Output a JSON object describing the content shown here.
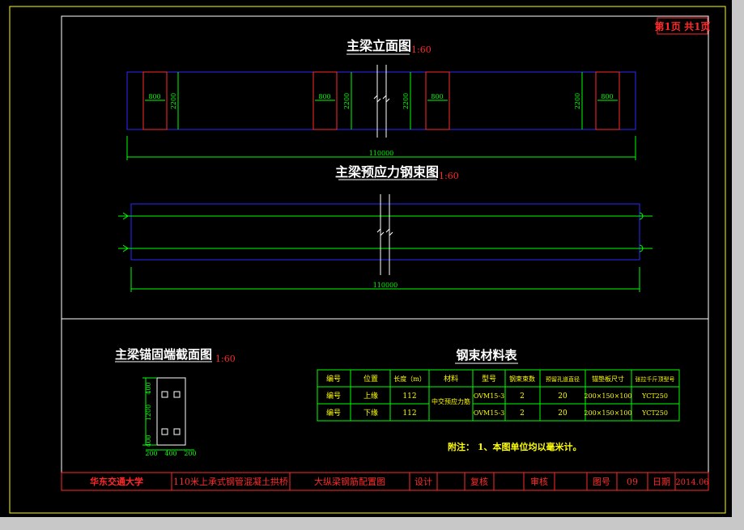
{
  "page_indicator": "第1页 共1页",
  "elevation": {
    "title": "主梁立面图",
    "scale": "1:60",
    "block_width": "800",
    "block_height": "2200",
    "total_length": "110000"
  },
  "tendon": {
    "title": "主梁预应力钢束图",
    "scale": "1:60",
    "total_length": "110000"
  },
  "anchor_section": {
    "title": "主梁锚固端截面图",
    "scale": "1:60",
    "dim_top": "400",
    "dim_mid": "1200",
    "dim_bottom": "400",
    "dim_left": "200",
    "dim_center": "400",
    "dim_right": "200"
  },
  "material_table": {
    "title": "钢束材料表",
    "headers": [
      "编号",
      "位置",
      "长度（m）",
      "材料",
      "型号",
      "钢束束数",
      "预留孔道直径",
      "锚垫板尺寸",
      "张拉千斤顶型号"
    ],
    "rows": [
      [
        "编号",
        "上缘",
        "112",
        "",
        "OVM15-3",
        "2",
        "20",
        "200×150×100",
        "YCT250"
      ],
      [
        "编号",
        "下缘",
        "112",
        "",
        "OVM15-3",
        "2",
        "20",
        "200×150×100",
        "YCT250"
      ]
    ],
    "merged_material": "中交预应力筋"
  },
  "note": "附注：  1、本图单位均以毫米计。",
  "title_block": {
    "school": "华东交通大学",
    "project": "110米上承式钢管混凝土拱桥",
    "drawing": "大纵梁钢筋配置图",
    "design_label": "设计",
    "check_label": "复核",
    "review_label": "审核",
    "number_label": "图号",
    "number_value": "09",
    "date_label": "日期",
    "date_value": "2014.06"
  }
}
